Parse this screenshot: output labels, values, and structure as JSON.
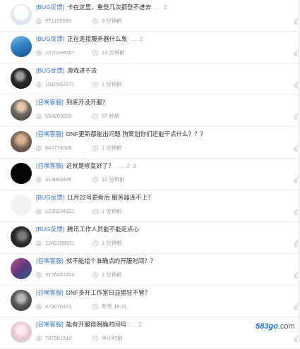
{
  "colors": {
    "tag": "#3b74c9",
    "title": "#333333",
    "meta": "#999999"
  },
  "posts": [
    {
      "tag": "[BUG反馈]",
      "title": "卡在这里，重登几次都登不进去",
      "pages": "... 2",
      "uid": "971192096",
      "time": "9 分钟前",
      "avatar": "whitish-avatar"
    },
    {
      "tag": "[BUG反馈]",
      "title": "正在连接服务器什么鬼",
      "pages": "... 2",
      "uid": "1070340357",
      "time": "13 分钟前",
      "avatar": "blue-scene-avatar"
    },
    {
      "tag": "[BUG反馈]",
      "title": "游戏进不去",
      "pages": "",
      "uid": "1012562071",
      "time": "1 分钟前",
      "avatar": "dark-portrait-avatar"
    },
    {
      "tag": "[召唤客服]",
      "title": "到底开没开服？",
      "pages": "",
      "uid": "564203020",
      "time": "57 秒前",
      "avatar": "photo-avatar"
    },
    {
      "tag": "[召唤客服]",
      "title": "DNF更新都能出问题 狗策划你们还能干点什么？？？",
      "pages": "",
      "uid": "842774328",
      "time": "1 分钟前",
      "avatar": "person-avatar"
    },
    {
      "tag": "[召唤客服]",
      "title": "这就是修复好了？",
      "pages": "... 2  3",
      "uid": "313860466",
      "time": "10 分钟前",
      "avatar": "black-avatar"
    },
    {
      "tag": "[BUG反馈]",
      "title": "11月22号更新后 服务器连不上？",
      "pages": "",
      "uid": "1239234921",
      "time": "1 分钟前",
      "avatar": "blank-avatar"
    },
    {
      "tag": "[BUG反馈]",
      "title": "腾讯工作人员能不能走点心",
      "pages": "",
      "uid": "1242188831",
      "time": "1 分钟前",
      "avatar": "dark-figure-avatar"
    },
    {
      "tag": "[召唤客服]",
      "title": "就不能给个准确点的开服时间？？",
      "pages": "",
      "uid": "3126497420",
      "time": "1 分钟前",
      "avatar": "colorful-avatar"
    },
    {
      "tag": "[召唤客服]",
      "title": "DNF多开工作室日益猖狂不管？",
      "pages": "",
      "uid": "479076441",
      "time": "昨天 18:41",
      "avatar": "grey-figure-avatar"
    },
    {
      "tag": "[召唤客服]",
      "title": "能有开服得明确时间吗",
      "pages": "... 2",
      "uid": "787561510",
      "time": "半小时前",
      "avatar": "light-character-avatar"
    }
  ],
  "watermark": {
    "part1": "583go",
    "part2": ".com"
  }
}
